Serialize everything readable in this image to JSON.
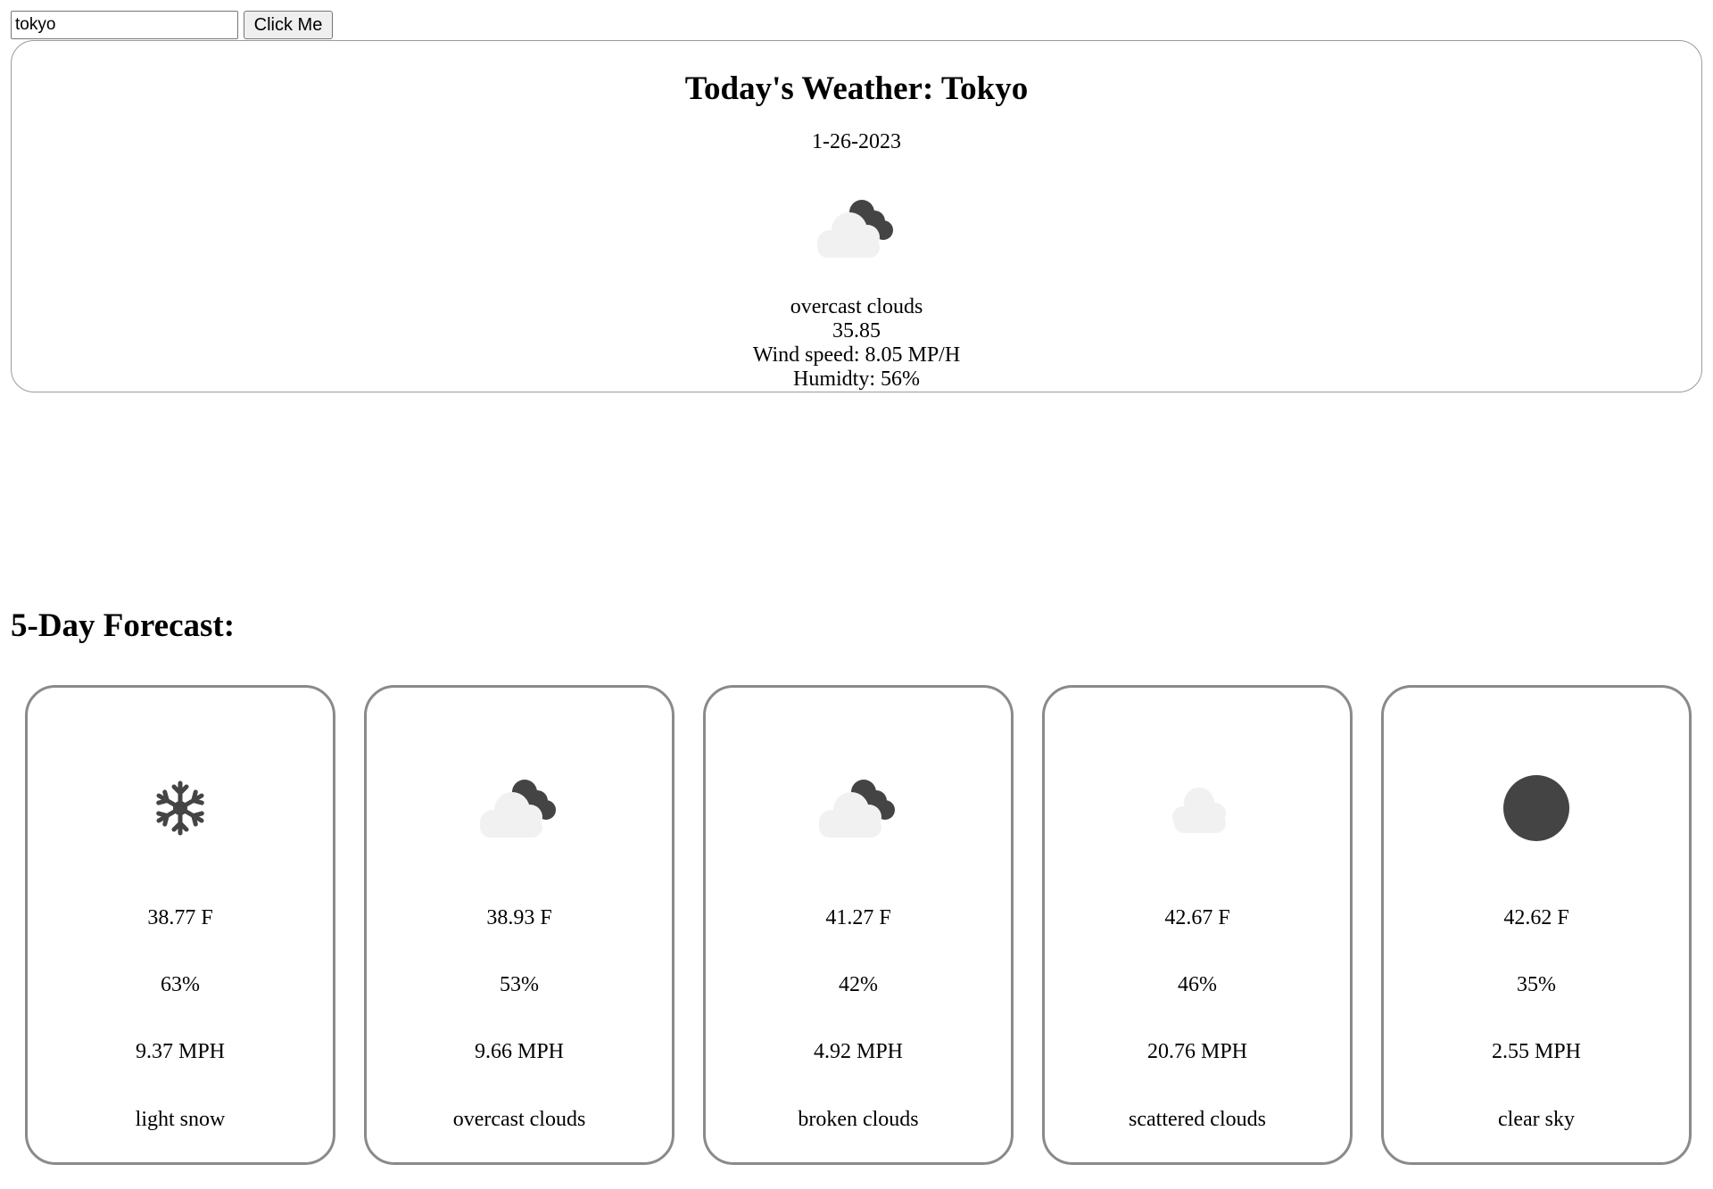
{
  "search": {
    "value": "tokyo",
    "button_label": "Click Me"
  },
  "today": {
    "title": "Today's Weather: Tokyo",
    "date": "1-26-2023",
    "icon": "cloud-dark-clouds-icon",
    "description": "overcast clouds",
    "temperature": "35.85",
    "wind": "Wind speed: 8.05 MP/H",
    "humidity": "Humidty: 56%"
  },
  "forecast": {
    "heading": "5-Day Forecast:",
    "days": [
      {
        "icon": "snowflake-icon",
        "temp": "38.77 F",
        "humidity": "63%",
        "wind": "9.37 MPH",
        "desc": "light snow"
      },
      {
        "icon": "overcast-clouds-icon",
        "temp": "38.93 F",
        "humidity": "53%",
        "wind": "9.66 MPH",
        "desc": "overcast clouds"
      },
      {
        "icon": "broken-clouds-icon",
        "temp": "41.27 F",
        "humidity": "42%",
        "wind": "4.92 MPH",
        "desc": "broken clouds"
      },
      {
        "icon": "scattered-clouds-icon",
        "temp": "42.67 F",
        "humidity": "46%",
        "wind": "20.76 MPH",
        "desc": "scattered clouds"
      },
      {
        "icon": "clear-sky-icon",
        "temp": "42.62 F",
        "humidity": "35%",
        "wind": "2.55 MPH",
        "desc": "clear sky"
      }
    ]
  },
  "colors": {
    "icon_light": "#f1f1f1",
    "icon_dark": "#444444",
    "card_border": "#8a8a8a"
  }
}
